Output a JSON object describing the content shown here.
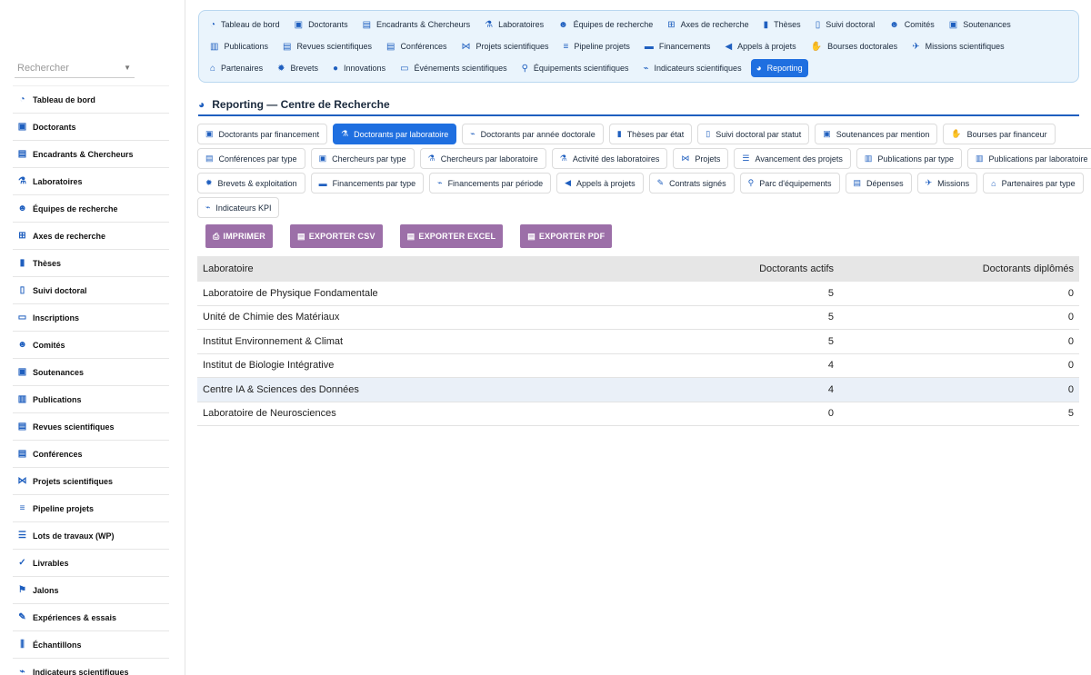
{
  "sidebar": {
    "search_placeholder": "Rechercher",
    "items": [
      {
        "label": "Tableau de bord",
        "icon": "dashboard-icon",
        "glyph": "◔"
      },
      {
        "label": "Doctorants",
        "icon": "graduate-icon",
        "glyph": "▣"
      },
      {
        "label": "Encadrants & Chercheurs",
        "icon": "chalkboard-icon",
        "glyph": "▤"
      },
      {
        "label": "Laboratoires",
        "icon": "flask-icon",
        "glyph": "⚗"
      },
      {
        "label": "Équipes de recherche",
        "icon": "users-icon",
        "glyph": "☻"
      },
      {
        "label": "Axes de recherche",
        "icon": "sitemap-icon",
        "glyph": "⊞"
      },
      {
        "label": "Thèses",
        "icon": "book-icon",
        "glyph": "▮"
      },
      {
        "label": "Suivi doctoral",
        "icon": "clipboard-icon",
        "glyph": "▯"
      },
      {
        "label": "Inscriptions",
        "icon": "id-card-icon",
        "glyph": "▭"
      },
      {
        "label": "Comités",
        "icon": "users-icon",
        "glyph": "☻"
      },
      {
        "label": "Soutenances",
        "icon": "presenter-icon",
        "glyph": "▣"
      },
      {
        "label": "Publications",
        "icon": "open-book-icon",
        "glyph": "▥"
      },
      {
        "label": "Revues scientifiques",
        "icon": "newspaper-icon",
        "glyph": "▤"
      },
      {
        "label": "Conférences",
        "icon": "chalkboard-icon",
        "glyph": "▤"
      },
      {
        "label": "Projets scientifiques",
        "icon": "project-diagram-icon",
        "glyph": "⋈"
      },
      {
        "label": "Pipeline projets",
        "icon": "list-icon",
        "glyph": "≡"
      },
      {
        "label": "Lots de travaux (WP)",
        "icon": "tasks-icon",
        "glyph": "☰"
      },
      {
        "label": "Livrables",
        "icon": "clipboard-check-icon",
        "glyph": "✓"
      },
      {
        "label": "Jalons",
        "icon": "flag-icon",
        "glyph": "⚑"
      },
      {
        "label": "Expériences & essais",
        "icon": "vial-icon",
        "glyph": "✎"
      },
      {
        "label": "Échantillons",
        "icon": "vials-icon",
        "glyph": "⫼"
      },
      {
        "label": "Indicateurs scientifiques",
        "icon": "chart-line-icon",
        "glyph": "⌁"
      }
    ]
  },
  "topnav": {
    "rows": [
      [
        {
          "label": "Tableau de bord",
          "icon": "dashboard-icon",
          "glyph": "◔"
        },
        {
          "label": "Doctorants",
          "icon": "graduate-icon",
          "glyph": "▣"
        },
        {
          "label": "Encadrants & Chercheurs",
          "icon": "chalkboard-icon",
          "glyph": "▤"
        },
        {
          "label": "Laboratoires",
          "icon": "flask-icon",
          "glyph": "⚗"
        },
        {
          "label": "Équipes de recherche",
          "icon": "users-icon",
          "glyph": "☻"
        },
        {
          "label": "Axes de recherche",
          "icon": "sitemap-icon",
          "glyph": "⊞"
        },
        {
          "label": "Thèses",
          "icon": "book-icon",
          "glyph": "▮"
        },
        {
          "label": "Suivi doctoral",
          "icon": "clipboard-icon",
          "glyph": "▯"
        },
        {
          "label": "Comités",
          "icon": "users-icon",
          "glyph": "☻"
        },
        {
          "label": "Soutenances",
          "icon": "presenter-icon",
          "glyph": "▣"
        }
      ],
      [
        {
          "label": "Publications",
          "icon": "open-book-icon",
          "glyph": "▥"
        },
        {
          "label": "Revues scientifiques",
          "icon": "newspaper-icon",
          "glyph": "▤"
        },
        {
          "label": "Conférences",
          "icon": "chalkboard-icon",
          "glyph": "▤"
        },
        {
          "label": "Projets scientifiques",
          "icon": "project-diagram-icon",
          "glyph": "⋈"
        },
        {
          "label": "Pipeline projets",
          "icon": "list-icon",
          "glyph": "≡"
        },
        {
          "label": "Financements",
          "icon": "money-icon",
          "glyph": "▬"
        },
        {
          "label": "Appels à projets",
          "icon": "bullhorn-icon",
          "glyph": "◀"
        },
        {
          "label": "Bourses doctorales",
          "icon": "hand-holding-icon",
          "glyph": "✋"
        },
        {
          "label": "Missions scientifiques",
          "icon": "plane-icon",
          "glyph": "✈"
        }
      ],
      [
        {
          "label": "Partenaires",
          "icon": "landmark-icon",
          "glyph": "⌂"
        },
        {
          "label": "Brevets",
          "icon": "certificate-icon",
          "glyph": "✹"
        },
        {
          "label": "Innovations",
          "icon": "lightbulb-icon",
          "glyph": "●"
        },
        {
          "label": "Événements scientifiques",
          "icon": "laptop-icon",
          "glyph": "▭"
        },
        {
          "label": "Équipements scientifiques",
          "icon": "microscope-icon",
          "glyph": "⚲"
        },
        {
          "label": "Indicateurs scientifiques",
          "icon": "chart-line-icon",
          "glyph": "⌁"
        },
        {
          "label": "Reporting",
          "icon": "pie-chart-icon",
          "glyph": "◕",
          "active": true
        }
      ]
    ]
  },
  "page": {
    "title": "Reporting — Centre de Recherche"
  },
  "report_tabs": [
    [
      {
        "label": "Doctorants par financement",
        "icon": "graduate-icon",
        "glyph": "▣"
      },
      {
        "label": "Doctorants par laboratoire",
        "icon": "flask-icon",
        "glyph": "⚗",
        "active": true
      },
      {
        "label": "Doctorants par année doctorale",
        "icon": "chart-line-icon",
        "glyph": "⌁"
      },
      {
        "label": "Thèses par état",
        "icon": "book-icon",
        "glyph": "▮"
      },
      {
        "label": "Suivi doctoral par statut",
        "icon": "clipboard-icon",
        "glyph": "▯"
      },
      {
        "label": "Soutenances par mention",
        "icon": "presenter-icon",
        "glyph": "▣"
      },
      {
        "label": "Bourses par financeur",
        "icon": "hand-holding-icon",
        "glyph": "✋"
      }
    ],
    [
      {
        "label": "Conférences par type",
        "icon": "chalkboard-icon",
        "glyph": "▤"
      },
      {
        "label": "Chercheurs par type",
        "icon": "graduate-icon",
        "glyph": "▣"
      },
      {
        "label": "Chercheurs par laboratoire",
        "icon": "flask-icon",
        "glyph": "⚗"
      },
      {
        "label": "Activité des laboratoires",
        "icon": "flask-icon",
        "glyph": "⚗"
      },
      {
        "label": "Projets",
        "icon": "project-diagram-icon",
        "glyph": "⋈"
      },
      {
        "label": "Avancement des projets",
        "icon": "tasks-icon",
        "glyph": "☰"
      },
      {
        "label": "Publications par type",
        "icon": "open-book-icon",
        "glyph": "▥"
      },
      {
        "label": "Publications par laboratoire",
        "icon": "open-book-icon",
        "glyph": "▥"
      }
    ],
    [
      {
        "label": "Brevets & exploitation",
        "icon": "certificate-icon",
        "glyph": "✹"
      },
      {
        "label": "Financements par type",
        "icon": "money-icon",
        "glyph": "▬"
      },
      {
        "label": "Financements par période",
        "icon": "chart-line-icon",
        "glyph": "⌁"
      },
      {
        "label": "Appels à projets",
        "icon": "bullhorn-icon",
        "glyph": "◀"
      },
      {
        "label": "Contrats signés",
        "icon": "file-signature-icon",
        "glyph": "✎"
      },
      {
        "label": "Parc d'équipements",
        "icon": "microscope-icon",
        "glyph": "⚲"
      },
      {
        "label": "Dépenses",
        "icon": "receipt-icon",
        "glyph": "▤"
      },
      {
        "label": "Missions",
        "icon": "plane-icon",
        "glyph": "✈"
      },
      {
        "label": "Partenaires par type",
        "icon": "landmark-icon",
        "glyph": "⌂"
      }
    ],
    [
      {
        "label": "Indicateurs KPI",
        "icon": "chart-line-icon",
        "glyph": "⌁"
      }
    ]
  ],
  "export_buttons": [
    {
      "label": "IMPRIMER",
      "icon": "print-icon",
      "glyph": "⎙",
      "name": "print-button"
    },
    {
      "label": "EXPORTER CSV",
      "icon": "file-csv-icon",
      "glyph": "▤",
      "name": "export-csv-button"
    },
    {
      "label": "EXPORTER EXCEL",
      "icon": "file-excel-icon",
      "glyph": "▤",
      "name": "export-excel-button"
    },
    {
      "label": "EXPORTER PDF",
      "icon": "file-pdf-icon",
      "glyph": "▤",
      "name": "export-pdf-button"
    }
  ],
  "table": {
    "headers": [
      "Laboratoire",
      "Doctorants actifs",
      "Doctorants diplômés"
    ],
    "rows": [
      [
        "Laboratoire de Physique Fondamentale",
        "5",
        "0"
      ],
      [
        "Unité de Chimie des Matériaux",
        "5",
        "0"
      ],
      [
        "Institut Environnement & Climat",
        "5",
        "0"
      ],
      [
        "Institut de Biologie Intégrative",
        "4",
        "0"
      ],
      [
        "Centre IA & Sciences des Données",
        "4",
        "0"
      ],
      [
        "Laboratoire de Neurosciences",
        "0",
        "5"
      ]
    ]
  },
  "colors": {
    "accent": "#1f6fe0",
    "export_button": "#9c6fa8",
    "nav_background": "#eaf4fc"
  }
}
